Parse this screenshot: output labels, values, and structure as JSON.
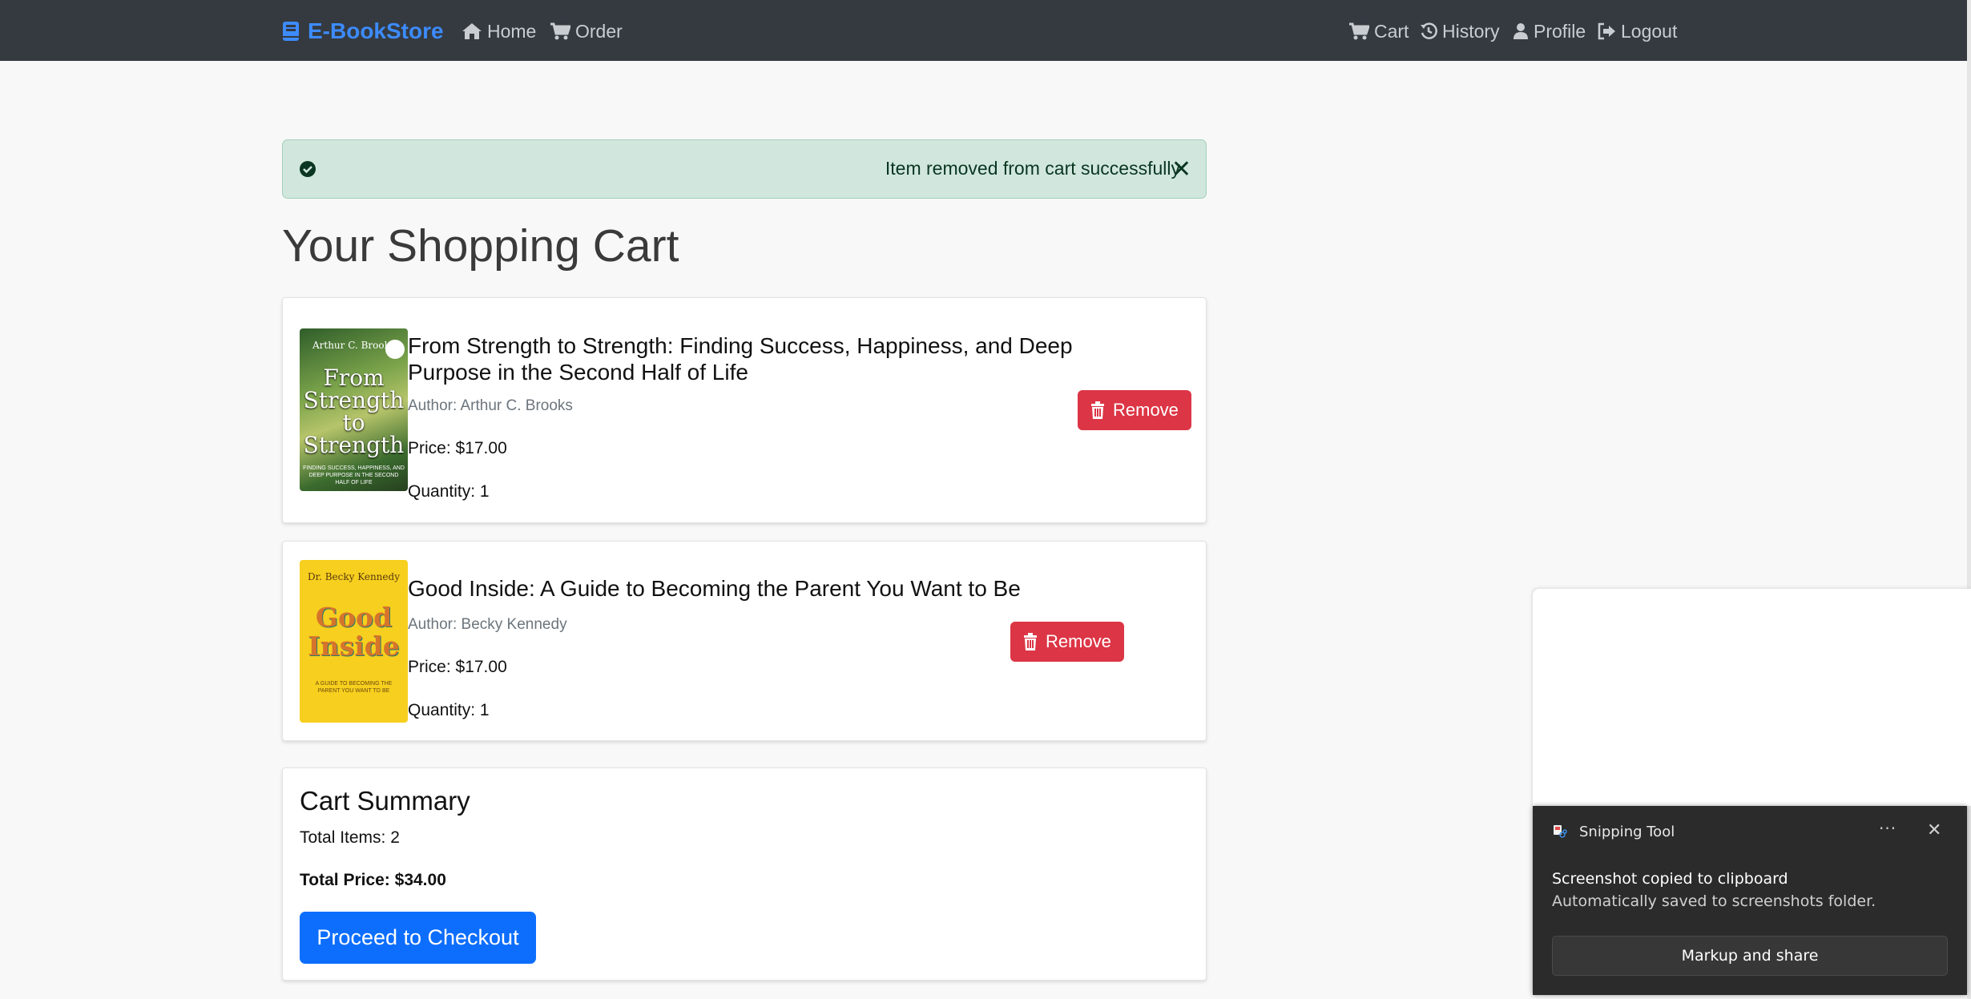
{
  "navbar": {
    "brand": "E-BookStore",
    "left_links": [
      {
        "label": "Home",
        "icon": "home-icon"
      },
      {
        "label": "Order",
        "icon": "cart-icon"
      }
    ],
    "right_links": [
      {
        "label": "Cart",
        "icon": "cart-icon"
      },
      {
        "label": "History",
        "icon": "history-icon"
      },
      {
        "label": "Profile",
        "icon": "user-icon"
      },
      {
        "label": "Logout",
        "icon": "logout-icon"
      }
    ]
  },
  "alert": {
    "message": "Item removed from cart successfully",
    "close": "✕",
    "status": "success"
  },
  "page": {
    "title": "Your Shopping Cart"
  },
  "cart": {
    "items": [
      {
        "title": "From Strength to Strength: Finding Success, Happiness, and Deep Purpose in the Second Half of Life",
        "author": "Author: Arthur C. Brooks",
        "price": "Price: $17.00",
        "quantity": "Quantity: 1",
        "remove_label": "Remove",
        "cover": {
          "author": "Arthur C. Brooks",
          "title": "From Strength to Strength",
          "subtitle": "FINDING SUCCESS, HAPPINESS, AND DEEP PURPOSE IN THE SECOND HALF OF LIFE"
        }
      },
      {
        "title": "Good Inside: A Guide to Becoming the Parent You Want to Be",
        "author": "Author: Becky Kennedy",
        "price": "Price: $17.00",
        "quantity": "Quantity: 1",
        "remove_label": "Remove",
        "cover": {
          "author": "Dr. Becky Kennedy",
          "title": "Good Inside",
          "subtitle": "A GUIDE TO BECOMING THE PARENT YOU WANT TO BE"
        }
      }
    ]
  },
  "summary": {
    "title": "Cart Summary",
    "total_items": "Total Items: 2",
    "total_price": "Total Price: $34.00",
    "checkout_label": "Proceed to Checkout"
  },
  "toast": {
    "app_name": "Snipping Tool",
    "more": "···",
    "close": "✕",
    "message": "Screenshot copied to clipboard",
    "submessage": "Automatically saved to screenshots folder.",
    "button_label": "Markup and share"
  },
  "colors": {
    "navbar_bg": "#343a40",
    "brand": "#3d8bfd",
    "alert_bg": "#d1e7dd",
    "remove": "#dc3545",
    "checkout": "#0d6efd"
  }
}
